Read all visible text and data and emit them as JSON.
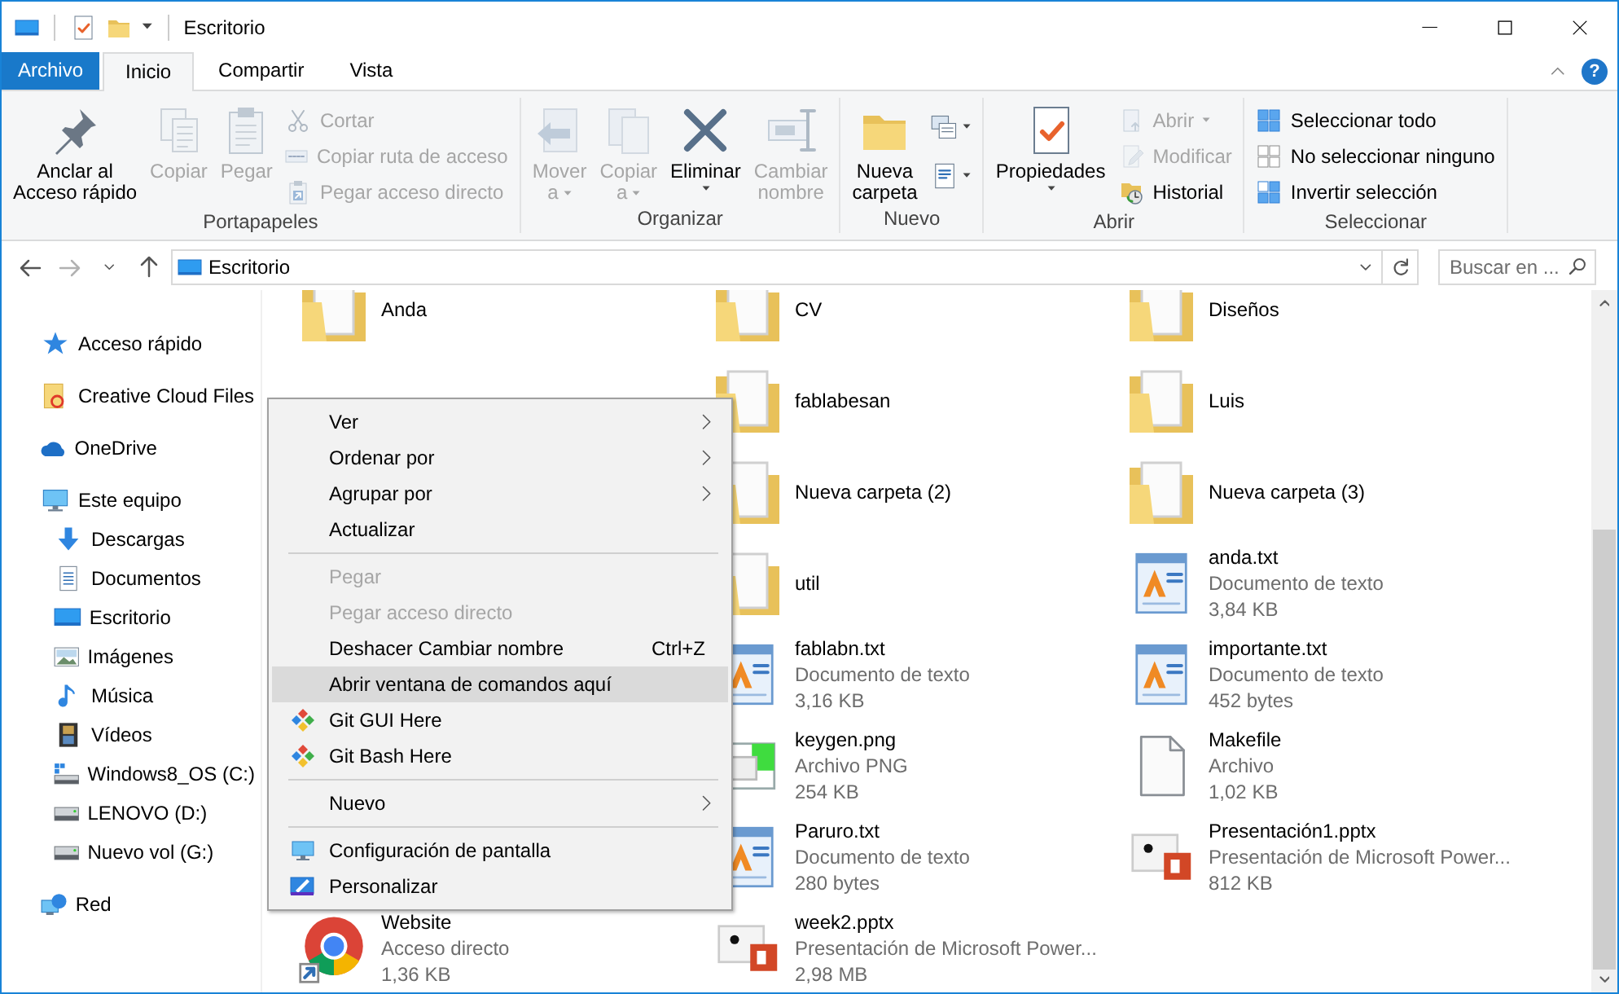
{
  "window": {
    "title": "Escritorio"
  },
  "ribbon_tabs": [
    {
      "label": "Archivo",
      "kind": "file",
      "selected": false
    },
    {
      "label": "Inicio",
      "kind": "tab",
      "selected": true
    },
    {
      "label": "Compartir",
      "kind": "tab",
      "selected": false
    },
    {
      "label": "Vista",
      "kind": "tab",
      "selected": false
    }
  ],
  "help_label": "?",
  "ribbon_groups": [
    {
      "label": "Portapapeles",
      "items": [
        {
          "kind": "large",
          "label": "Anclar al\nAcceso rápido",
          "disabled": false,
          "dropdown": false
        },
        {
          "kind": "large",
          "label": "Copiar",
          "disabled": true,
          "dropdown": false
        },
        {
          "kind": "large",
          "label": "Pegar",
          "disabled": true,
          "dropdown": false
        },
        {
          "kind": "stack",
          "items": [
            {
              "kind": "small",
              "label": "Cortar",
              "disabled": true,
              "dropdown": false
            },
            {
              "kind": "small",
              "label": "Copiar ruta de acceso",
              "disabled": true,
              "dropdown": false
            },
            {
              "kind": "small",
              "label": "Pegar acceso directo",
              "disabled": true,
              "dropdown": false
            }
          ]
        }
      ]
    },
    {
      "label": "Organizar",
      "items": [
        {
          "kind": "large",
          "label": "Mover\na",
          "disabled": true,
          "dropdown": true
        },
        {
          "kind": "large",
          "label": "Copiar\na",
          "disabled": true,
          "dropdown": true
        },
        {
          "kind": "large",
          "label": "Eliminar",
          "disabled": false,
          "dropdown": true
        },
        {
          "kind": "large",
          "label": "Cambiar\nnombre",
          "disabled": true,
          "dropdown": false
        }
      ]
    },
    {
      "label": "Nuevo",
      "items": [
        {
          "kind": "large",
          "label": "Nueva\ncarpeta",
          "disabled": false,
          "dropdown": false
        },
        {
          "kind": "stack",
          "items": [
            {
              "kind": "icon",
              "disabled": false,
              "dropdown": true
            },
            {
              "kind": "icon",
              "disabled": false,
              "dropdown": true
            }
          ]
        }
      ]
    },
    {
      "label": "Abrir",
      "items": [
        {
          "kind": "large",
          "label": "Propiedades",
          "disabled": false,
          "dropdown": true
        },
        {
          "kind": "stack",
          "items": [
            {
              "kind": "small",
              "label": "Abrir",
              "disabled": true,
              "dropdown": true
            },
            {
              "kind": "small",
              "label": "Modificar",
              "disabled": true,
              "dropdown": false
            },
            {
              "kind": "small",
              "label": "Historial",
              "disabled": false,
              "dropdown": false
            }
          ]
        }
      ]
    },
    {
      "label": "Seleccionar",
      "items": [
        {
          "kind": "stack",
          "items": [
            {
              "kind": "small",
              "label": "Seleccionar todo",
              "disabled": false,
              "dropdown": false
            },
            {
              "kind": "small",
              "label": "No seleccionar ninguno",
              "disabled": false,
              "dropdown": false
            },
            {
              "kind": "small",
              "label": "Invertir selección",
              "disabled": false,
              "dropdown": false
            }
          ]
        }
      ]
    }
  ],
  "nav_buttons": [
    {
      "kind": "back",
      "disabled": false
    },
    {
      "kind": "forward",
      "disabled": true
    },
    {
      "kind": "recent",
      "disabled": false
    },
    {
      "kind": "up",
      "disabled": false
    }
  ],
  "address": {
    "location": "Escritorio",
    "search": {
      "placeholder": "Buscar en ..."
    }
  },
  "navigation": [
    {
      "label": "Acceso rápido"
    },
    {
      "label": "Creative Cloud Files"
    },
    {
      "label": "OneDrive"
    },
    {
      "label": "Este equipo",
      "children": [
        {
          "label": "Descargas"
        },
        {
          "label": "Documentos"
        },
        {
          "label": "Escritorio"
        },
        {
          "label": "Imágenes"
        },
        {
          "label": "Música"
        },
        {
          "label": "Vídeos"
        },
        {
          "label": "Windows8_OS (C:)"
        },
        {
          "label": "LENOVO (D:)"
        },
        {
          "label": "Nuevo vol (G:)"
        }
      ]
    },
    {
      "label": "Red"
    }
  ],
  "files": {
    "columns": [
      [
        {
          "name": "Anda",
          "kind": "folder"
        },
        {
          "name": "Website",
          "type": "Acceso directo",
          "size": "1,36 KB",
          "kind": "shortcut"
        }
      ],
      [
        {
          "name": "CV",
          "kind": "folder"
        },
        {
          "name": "fablabesan",
          "kind": "folder"
        },
        {
          "name": "Nueva carpeta (2)",
          "kind": "folder"
        },
        {
          "name": "util",
          "kind": "folder"
        },
        {
          "name": "fablabn.txt",
          "type": "Documento de texto",
          "size": "3,16 KB",
          "kind": "text"
        },
        {
          "name": "keygen.png",
          "type": "Archivo PNG",
          "size": "254 KB",
          "kind": "image"
        },
        {
          "name": "Paruro.txt",
          "type": "Documento de texto",
          "size": "280 bytes",
          "kind": "text"
        },
        {
          "name": "week2.pptx",
          "type": "Presentación de Microsoft Power...",
          "size": "2,98 MB",
          "kind": "slides"
        }
      ],
      [
        {
          "name": "Diseños",
          "kind": "folder"
        },
        {
          "name": "Luis",
          "kind": "folder"
        },
        {
          "name": "Nueva carpeta (3)",
          "kind": "folder"
        },
        {
          "name": "anda.txt",
          "type": "Documento de texto",
          "size": "3,84 KB",
          "kind": "text"
        },
        {
          "name": "importante.txt",
          "type": "Documento de texto",
          "size": "452 bytes",
          "kind": "text"
        },
        {
          "name": "Makefile",
          "type": "Archivo",
          "size": "1,02 KB",
          "kind": "blank"
        },
        {
          "name": "Presentación1.pptx",
          "type": "Presentación de Microsoft Power...",
          "size": "812 KB",
          "kind": "slides"
        }
      ]
    ]
  },
  "context_menu": {
    "items": [
      {
        "kind": "item",
        "label": "Ver",
        "submenu": true,
        "disabled": false,
        "selected": false
      },
      {
        "kind": "item",
        "label": "Ordenar por",
        "submenu": true,
        "disabled": false,
        "selected": false
      },
      {
        "kind": "item",
        "label": "Agrupar por",
        "submenu": true,
        "disabled": false,
        "selected": false
      },
      {
        "kind": "item",
        "label": "Actualizar",
        "submenu": false,
        "disabled": false,
        "selected": false
      },
      {
        "kind": "separator"
      },
      {
        "kind": "item",
        "label": "Pegar",
        "submenu": false,
        "disabled": true,
        "selected": false
      },
      {
        "kind": "item",
        "label": "Pegar acceso directo",
        "submenu": false,
        "disabled": true,
        "selected": false
      },
      {
        "kind": "item",
        "label": "Deshacer Cambiar nombre",
        "shortcut": "Ctrl+Z",
        "submenu": false,
        "disabled": false,
        "selected": false
      },
      {
        "kind": "item",
        "label": "Abrir ventana de comandos aquí",
        "submenu": false,
        "disabled": false,
        "selected": true
      },
      {
        "kind": "item",
        "label": "Git GUI Here",
        "submenu": false,
        "disabled": false,
        "selected": false
      },
      {
        "kind": "item",
        "label": "Git Bash Here",
        "submenu": false,
        "disabled": false,
        "selected": false
      },
      {
        "kind": "separator"
      },
      {
        "kind": "item",
        "label": "Nuevo",
        "submenu": true,
        "disabled": false,
        "selected": false
      },
      {
        "kind": "separator"
      },
      {
        "kind": "item",
        "label": "Configuración de pantalla",
        "submenu": false,
        "disabled": false,
        "selected": false
      },
      {
        "kind": "item",
        "label": "Personalizar",
        "submenu": false,
        "disabled": false,
        "selected": false
      }
    ]
  }
}
